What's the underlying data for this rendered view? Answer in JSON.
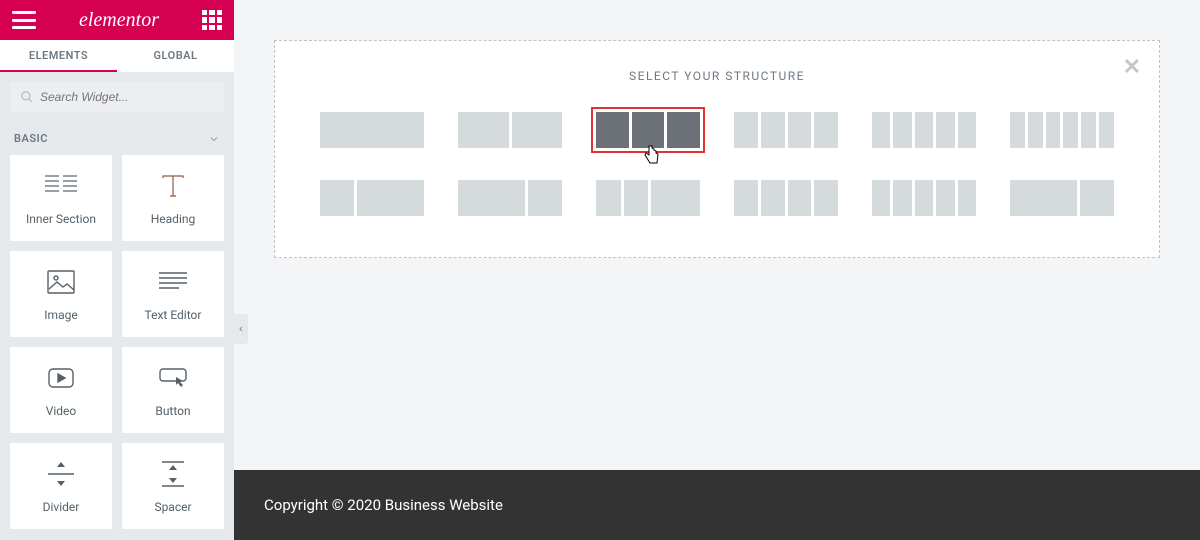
{
  "header": {
    "brand": "elementor"
  },
  "tabs": [
    {
      "id": "elements",
      "label": "ELEMENTS",
      "active": true
    },
    {
      "id": "global",
      "label": "GLOBAL",
      "active": false
    }
  ],
  "search": {
    "placeholder": "Search Widget..."
  },
  "category": {
    "label": "BASIC"
  },
  "widgets": [
    {
      "id": "inner-section",
      "label": "Inner Section",
      "icon": "columns-icon"
    },
    {
      "id": "heading",
      "label": "Heading",
      "icon": "text-t-icon"
    },
    {
      "id": "image",
      "label": "Image",
      "icon": "image-icon"
    },
    {
      "id": "text-editor",
      "label": "Text Editor",
      "icon": "lines-icon"
    },
    {
      "id": "video",
      "label": "Video",
      "icon": "play-icon"
    },
    {
      "id": "button",
      "label": "Button",
      "icon": "button-icon"
    },
    {
      "id": "divider",
      "label": "Divider",
      "icon": "divider-icon"
    },
    {
      "id": "spacer",
      "label": "Spacer",
      "icon": "spacer-icon"
    }
  ],
  "structure": {
    "title": "SELECT YOUR STRUCTURE",
    "selected_index": 2,
    "row1": [
      {
        "cols": [
          1
        ]
      },
      {
        "cols": [
          1,
          1
        ]
      },
      {
        "cols": [
          1,
          1,
          1
        ]
      },
      {
        "cols": [
          1,
          1,
          1,
          1
        ]
      },
      {
        "cols": [
          1,
          1,
          1,
          1,
          1
        ]
      },
      {
        "cols": [
          1,
          1,
          1,
          1,
          1,
          1
        ]
      }
    ],
    "row2": [
      {
        "cols": [
          1,
          2
        ]
      },
      {
        "cols": [
          2,
          1
        ]
      },
      {
        "cols": [
          1,
          1,
          2
        ]
      },
      {
        "cols": [
          1,
          1,
          1,
          1
        ]
      },
      {
        "cols": [
          1,
          1,
          1,
          1,
          1
        ]
      },
      {
        "cols": [
          2,
          1
        ]
      }
    ]
  },
  "footer": {
    "copyright": "Copyright © 2020 Business Website"
  }
}
